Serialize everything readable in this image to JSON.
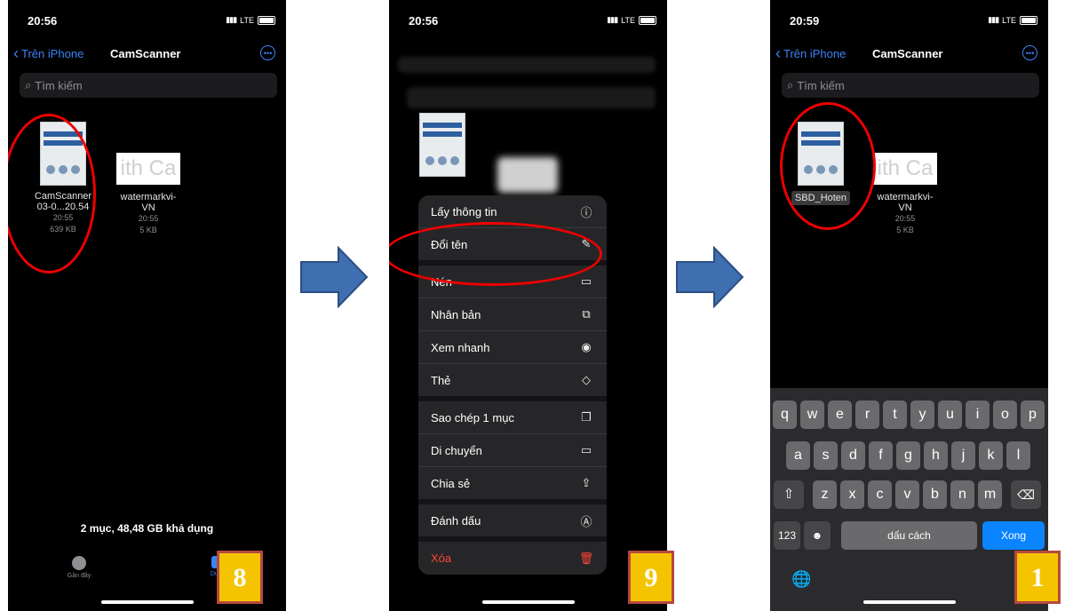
{
  "status": {
    "time_1": "20:56",
    "time_2": "20:56",
    "time_3": "20:59",
    "carrier": "LTE"
  },
  "nav": {
    "back_label": "Trên iPhone",
    "title": "CamScanner",
    "search_placeholder": "Tìm kiếm"
  },
  "panel1": {
    "file1": {
      "name_line1": "CamScanner",
      "name_line2": "03-0...20.54",
      "time": "20:55",
      "size": "639 KB"
    },
    "file2": {
      "name_line1": "watermarkvi-",
      "name_line2": "VN",
      "time": "20:55",
      "size": "5 KB"
    },
    "storage": "2 mục, 48,48 GB khả dụng",
    "tab_recent": "Gần đây",
    "tab_browse": "Duyệt",
    "step": "8"
  },
  "panel2": {
    "menu": [
      {
        "label": "Lấy thông tin",
        "icon": "info-icon"
      },
      {
        "label": "Đổi tên",
        "icon": "pencil-icon"
      },
      {
        "label": "Nén",
        "icon": "archive-icon"
      },
      {
        "label": "Nhân bản",
        "icon": "duplicate-icon"
      },
      {
        "label": "Xem nhanh",
        "icon": "eye-icon"
      },
      {
        "label": "Thẻ",
        "icon": "tag-icon"
      },
      {
        "label": "Sao chép 1 mục",
        "icon": "copy-icon"
      },
      {
        "label": "Di chuyển",
        "icon": "folder-icon"
      },
      {
        "label": "Chia sẻ",
        "icon": "share-icon"
      },
      {
        "label": "Đánh dấu",
        "icon": "markup-icon"
      },
      {
        "label": "Xóa",
        "icon": "trash-icon"
      }
    ],
    "step": "9"
  },
  "panel3": {
    "file1": {
      "name": "SBD_Hoten"
    },
    "file2": {
      "name_line1": "watermarkvi-",
      "name_line2": "VN",
      "time": "20:55",
      "size": "5 KB"
    },
    "keyboard": {
      "row1": [
        "q",
        "w",
        "e",
        "r",
        "t",
        "y",
        "u",
        "i",
        "o",
        "p"
      ],
      "row2": [
        "a",
        "s",
        "d",
        "f",
        "g",
        "h",
        "j",
        "k",
        "l"
      ],
      "row3": [
        "z",
        "x",
        "c",
        "v",
        "b",
        "n",
        "m"
      ],
      "numbers_label": "123",
      "space_label": "dấu cách",
      "done_label": "Xong"
    },
    "step": "1"
  },
  "colors": {
    "accent": "#3b82f6",
    "badge": "#f5c400",
    "highlight": "#e00000",
    "arrow": "#3f6fb0"
  }
}
